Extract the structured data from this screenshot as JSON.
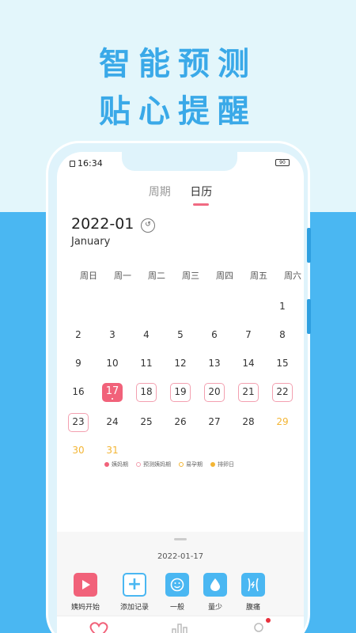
{
  "promo": {
    "line1": "智能预测",
    "line2": "贴心提醒"
  },
  "status": {
    "time": "16:34",
    "battery": "90"
  },
  "tabs": [
    {
      "label": "周期",
      "active": false
    },
    {
      "label": "日历",
      "active": true
    }
  ],
  "calendar": {
    "month": "2022-01",
    "month_en": "January",
    "weekdays": [
      "周日",
      "周一",
      "周二",
      "周三",
      "周四",
      "周五",
      "周六"
    ],
    "weeks": [
      [
        null,
        null,
        null,
        null,
        null,
        null,
        {
          "d": "1"
        }
      ],
      [
        {
          "d": "2"
        },
        {
          "d": "3"
        },
        {
          "d": "4"
        },
        {
          "d": "5"
        },
        {
          "d": "6"
        },
        {
          "d": "7"
        },
        {
          "d": "8"
        }
      ],
      [
        {
          "d": "9"
        },
        {
          "d": "10"
        },
        {
          "d": "11"
        },
        {
          "d": "12"
        },
        {
          "d": "13"
        },
        {
          "d": "14"
        },
        {
          "d": "15"
        }
      ],
      [
        {
          "d": "16"
        },
        {
          "d": "17",
          "type": "period"
        },
        {
          "d": "18",
          "type": "predicted"
        },
        {
          "d": "19",
          "type": "predicted"
        },
        {
          "d": "20",
          "type": "predicted"
        },
        {
          "d": "21",
          "type": "predicted"
        },
        {
          "d": "22",
          "type": "predicted"
        }
      ],
      [
        {
          "d": "23",
          "type": "predicted"
        },
        {
          "d": "24"
        },
        {
          "d": "25"
        },
        {
          "d": "26"
        },
        {
          "d": "27"
        },
        {
          "d": "28"
        },
        {
          "d": "29",
          "type": "fertile"
        }
      ],
      [
        {
          "d": "30",
          "type": "fertile"
        },
        {
          "d": "31",
          "type": "fertile"
        },
        null,
        null,
        null,
        null,
        null
      ]
    ]
  },
  "legend": [
    {
      "label": "姨妈期",
      "color": "#f1627a",
      "style": "filled"
    },
    {
      "label": "预测姨妈期",
      "color": "#f3a0b0",
      "style": "ring"
    },
    {
      "label": "易孕期",
      "color": "#f3b534",
      "style": "ring"
    },
    {
      "label": "排卵日",
      "color": "#f3b534",
      "style": "filled"
    }
  ],
  "selected_date": "2022-01-17",
  "actions": [
    {
      "label": "姨妈开始",
      "icon": "play-icon"
    },
    {
      "label": "添加记录",
      "icon": "plus-icon"
    },
    {
      "label": "一般",
      "icon": "smile-icon"
    },
    {
      "label": "量少",
      "icon": "drop-icon"
    },
    {
      "label": "腹痛",
      "icon": "belly-icon"
    }
  ],
  "tabbar": [
    {
      "icon": "heart-icon"
    },
    {
      "icon": "chart-icon"
    },
    {
      "icon": "profile-icon",
      "badge": true
    }
  ],
  "colors": {
    "accent": "#f1627a",
    "brand_blue": "#4ab7f2",
    "fertile": "#f3b534"
  }
}
